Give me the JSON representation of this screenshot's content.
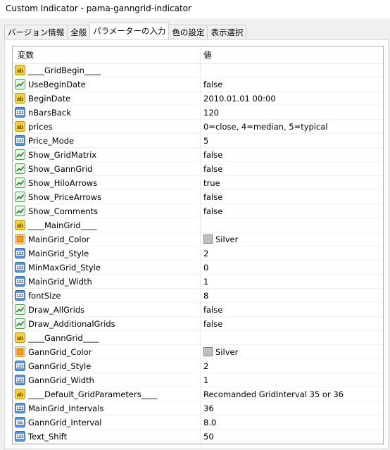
{
  "window": {
    "title": "Custom Indicator - pama-ganngrid-indicator"
  },
  "tabs": [
    {
      "label": "バージョン情報"
    },
    {
      "label": "全般"
    },
    {
      "label": "パラメーターの入力"
    },
    {
      "label": "色の設定"
    },
    {
      "label": "表示選択"
    }
  ],
  "active_tab": 2,
  "table": {
    "columns": {
      "variable": "変数",
      "value": "値"
    },
    "rows": [
      {
        "icon": "string",
        "name": "____GridBegin____",
        "value": ""
      },
      {
        "icon": "bool",
        "name": "UseBeginDate",
        "value": "false"
      },
      {
        "icon": "string",
        "name": "BeginDate",
        "value": "2010.01.01 00:00"
      },
      {
        "icon": "int",
        "name": "nBarsBack",
        "value": "120"
      },
      {
        "icon": "string",
        "name": "prices",
        "value": "0=close, 4=median, 5=typical"
      },
      {
        "icon": "int",
        "name": "Price_Mode",
        "value": "5"
      },
      {
        "icon": "bool",
        "name": "Show_GridMatrix",
        "value": "false"
      },
      {
        "icon": "bool",
        "name": "Show_GannGrid",
        "value": "false"
      },
      {
        "icon": "bool",
        "name": "Show_HiloArrows",
        "value": "true"
      },
      {
        "icon": "bool",
        "name": "Show_PriceArrows",
        "value": "false"
      },
      {
        "icon": "bool",
        "name": "Show_Comments",
        "value": "false"
      },
      {
        "icon": "string",
        "name": "____MainGrid____",
        "value": ""
      },
      {
        "icon": "color",
        "name": "MainGrid_Color",
        "value": "Silver",
        "swatch": "#c0c0c0"
      },
      {
        "icon": "int",
        "name": "MainGrid_Style",
        "value": "2"
      },
      {
        "icon": "int",
        "name": "MinMaxGrid_Style",
        "value": "0"
      },
      {
        "icon": "int",
        "name": "MainGrid_Width",
        "value": "1"
      },
      {
        "icon": "int",
        "name": "fontSize",
        "value": "8"
      },
      {
        "icon": "bool",
        "name": "Draw_AllGrids",
        "value": "false"
      },
      {
        "icon": "bool",
        "name": "Draw_AdditionalGrids",
        "value": "false"
      },
      {
        "icon": "string",
        "name": "____GannGrid____",
        "value": ""
      },
      {
        "icon": "color",
        "name": "GannGrid_Color",
        "value": "Silver",
        "swatch": "#c0c0c0"
      },
      {
        "icon": "int",
        "name": "GannGrid_Style",
        "value": "2"
      },
      {
        "icon": "int",
        "name": "GannGrid_Width",
        "value": "1"
      },
      {
        "icon": "string",
        "name": "____Default_GridParameters____",
        "value": "Recomanded GridInterval 35 or 36"
      },
      {
        "icon": "int",
        "name": "MainGrid_Intervals",
        "value": "36"
      },
      {
        "icon": "double",
        "name": "GannGrid_Interval",
        "value": "8.0"
      },
      {
        "icon": "int",
        "name": "Text_Shift",
        "value": "50"
      }
    ]
  },
  "icons": {
    "string": {
      "name": "string-ab-icon",
      "label": "ab"
    },
    "int": {
      "name": "integer-123-icon",
      "label": "123"
    },
    "bool": {
      "name": "boolean-toggle-icon",
      "label": ""
    },
    "color": {
      "name": "color-palette-icon",
      "label": ""
    },
    "double": {
      "name": "double-value-icon",
      "label": "Va"
    }
  }
}
